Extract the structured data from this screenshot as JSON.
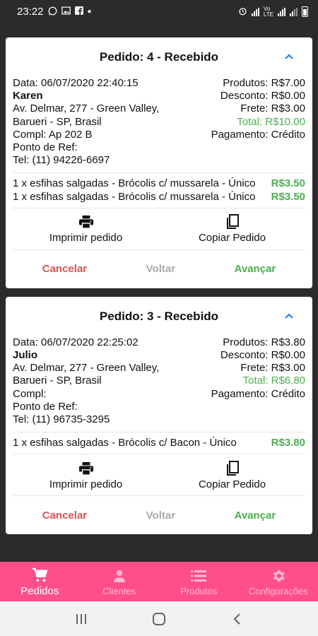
{
  "status_bar": {
    "time": "23:22"
  },
  "orders": [
    {
      "title": "Pedido: 4 - Recebido",
      "date": "Data: 06/07/2020 22:40:15",
      "name": "Karen",
      "address_line1": "Av. Delmar, 277 - Green Valley,",
      "address_line2": "Barueri - SP, Brasil",
      "compl": "Compl: Ap 202 B",
      "ref": "Ponto de Ref:",
      "tel": "Tel: (11) 94226-6697",
      "produtos": "Produtos: R$7.00",
      "desconto": "Desconto: R$0.00",
      "frete": "Frete: R$3.00",
      "total": "Total: R$10.00",
      "pagamento": "Pagamento: Crédito",
      "items": [
        {
          "text": "1 x esfihas salgadas - Brócolis c/ mussarela - Único",
          "price": "R$3.50"
        },
        {
          "text": "1 x esfihas salgadas - Brócolis c/ mussarela - Único",
          "price": "R$3.50"
        }
      ],
      "print_label": "Imprimir pedido",
      "copy_label": "Copiar Pedido",
      "cancel_label": "Cancelar",
      "back_label": "Voltar",
      "next_label": "Avançar"
    },
    {
      "title": "Pedido: 3 - Recebido",
      "date": "Data: 06/07/2020 22:25:02",
      "name": "Julio",
      "address_line1": "Av. Delmar, 277 - Green Valley,",
      "address_line2": "Barueri - SP, Brasil",
      "compl": "Compl:",
      "ref": "Ponto de Ref:",
      "tel": "Tel: (11) 96735-3295",
      "produtos": "Produtos: R$3.80",
      "desconto": "Desconto: R$0.00",
      "frete": "Frete: R$3.00",
      "total": "Total: R$6.80",
      "pagamento": "Pagamento: Crédito",
      "items": [
        {
          "text": "1 x esfihas salgadas - Brócolis c/ Bacon - Único",
          "price": "R$3.80"
        }
      ],
      "print_label": "Imprimir pedido",
      "copy_label": "Copiar Pedido",
      "cancel_label": "Cancelar",
      "back_label": "Voltar",
      "next_label": "Avançar"
    }
  ],
  "bottom_nav": [
    {
      "label": "Pedidos",
      "icon": "cart-icon"
    },
    {
      "label": "Clientes",
      "icon": "person-icon"
    },
    {
      "label": "Produtos",
      "icon": "list-icon"
    },
    {
      "label": "Configurações",
      "icon": "gear-icon"
    }
  ],
  "colors": {
    "accent": "#ff4f8a",
    "green": "#4caf50",
    "red": "#d9534f"
  }
}
